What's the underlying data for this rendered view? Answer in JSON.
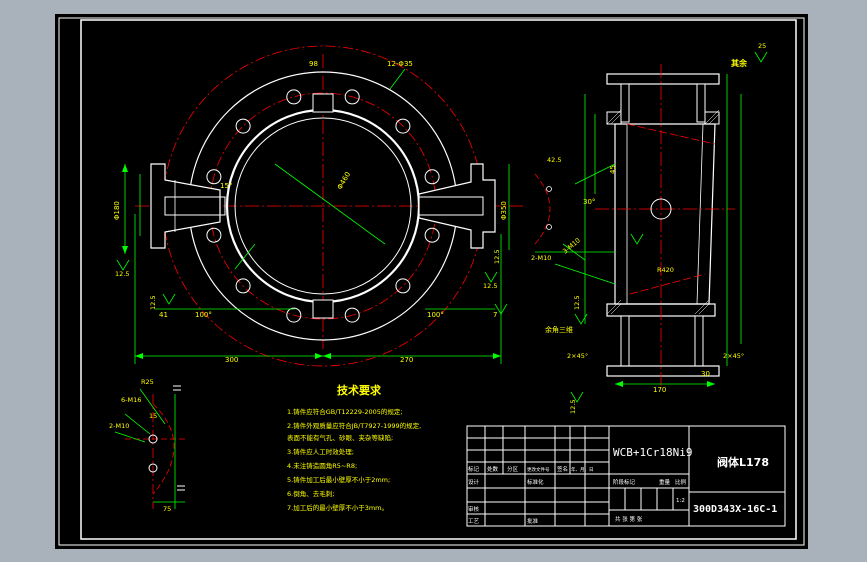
{
  "colors": {
    "background": "#a9b1bb",
    "sheet": "#000000",
    "outline": "#ffffff",
    "dimension": "#00ff00",
    "center_line": "#ff0000",
    "text_yellow": "#ffff00",
    "text_white": "#ffffff"
  },
  "front_view": {
    "top_dim": "98",
    "bolt_holes": "12-Φ35",
    "dia_460": "Φ460",
    "dia_left": "Φ180",
    "dia_right": "Φ350",
    "angle": "15°",
    "rough_left": "12.5",
    "rough_right": "12.5",
    "val_41": "41",
    "val_100": "100°",
    "val_100b": "100°",
    "val_7": "7",
    "val_125": "12.5",
    "val_125b": "12.5",
    "left_width": "300",
    "right_width": "270"
  },
  "side_view": {
    "note_rest": "其余",
    "rest_val": "25",
    "val_45": "45",
    "val_42": "42.5",
    "val_m10": "2-M10",
    "val_30": "30°",
    "val_radius": "R420",
    "val_threads": "3-M10",
    "label_sec": "余角三维",
    "val_2x45": "2×45°",
    "val_2x45b": "2×45°",
    "val_170": "170",
    "val_30b": "30",
    "val_125": "12.5",
    "val_125b": "12.5"
  },
  "detail_view": {
    "label_top": "R25",
    "label_m": "6-M16",
    "label_m2": "2-M10",
    "label_15": "15",
    "label_75": "75"
  },
  "notes": {
    "title": "技术要求",
    "items": [
      "1.铸件应符合GB/T12229-2005的规定;",
      "2.铸件外观质量应符合JB/T7927-1999的规定,",
      "  表面不能有气孔、砂眼、夹杂等缺陷;",
      "3.铸件应人工时效处理;",
      "4.未注铸造圆角R5~R8;",
      "5.铸件加工后最小壁厚不小于2mm;",
      "6.倒角、去毛刺;",
      "7.加工后的最小壁厚不小于3mm。"
    ]
  },
  "title_block": {
    "material": "WCB+1Cr18Ni9",
    "part_name": "阀体L178",
    "drawing_no": "300D343X-16C-1",
    "header_labels": [
      "标记",
      "处数",
      "分区",
      "更改文件号",
      "签名",
      "年、月、日"
    ],
    "row_design": "设计",
    "row_standard": "标准化",
    "row_review": "审核",
    "row_process": "工艺",
    "row_approve": "批准",
    "stage_labels": "阶段标记",
    "weight": "重量",
    "scale": "比例",
    "scale_value": "1:2",
    "sheets": "共  张  第  张"
  }
}
